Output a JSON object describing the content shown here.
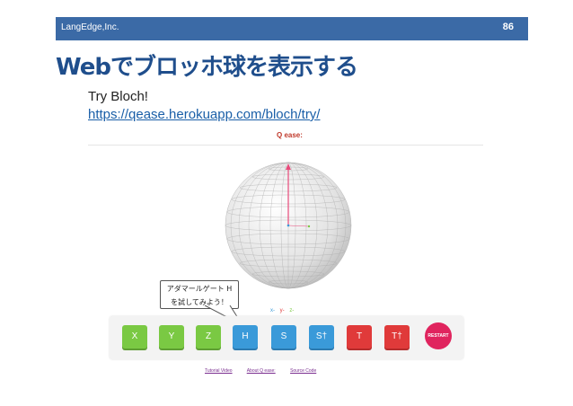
{
  "header": {
    "company": "LangEdge,Inc.",
    "page_number": "86"
  },
  "slide": {
    "title": "Webでブロッホ球を表示する",
    "try_label": "Try Bloch!",
    "url": "https://qease.herokuapp.com/bloch/try/"
  },
  "app": {
    "logo": "Q ease:",
    "callout": {
      "line1": "アダマールゲート H",
      "line2": "を試してみよう！"
    },
    "axes": {
      "x": "x-",
      "y": "y-",
      "z": "z-"
    },
    "gates": [
      "X",
      "Y",
      "Z",
      "H",
      "S",
      "S†",
      "T",
      "T†"
    ],
    "restart_label": "RESTART",
    "links": [
      "Tutorial Video",
      "About Q ease:",
      "Source Code"
    ],
    "colors": {
      "green": "#7ac943",
      "blue": "#3a9ad9",
      "red": "#e03a3a",
      "restart": "#e0245e",
      "header": "#3b6aa6",
      "title": "#1f4e8c"
    }
  }
}
